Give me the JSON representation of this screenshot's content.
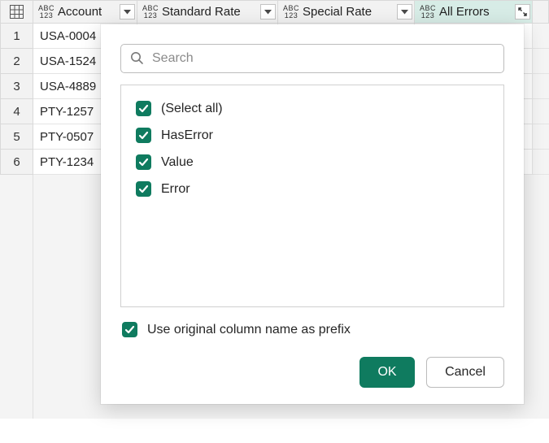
{
  "columns": [
    {
      "label": "Account",
      "width": 128,
      "active": false
    },
    {
      "label": "Standard Rate",
      "width": 173,
      "active": false
    },
    {
      "label": "Special Rate",
      "width": 168,
      "active": false
    },
    {
      "label": "All Errors",
      "width": 145,
      "active": true
    }
  ],
  "rows": [
    {
      "n": "1",
      "account": "USA-0004"
    },
    {
      "n": "2",
      "account": "USA-1524"
    },
    {
      "n": "3",
      "account": "USA-4889"
    },
    {
      "n": "4",
      "account": "PTY-1257"
    },
    {
      "n": "5",
      "account": "PTY-0507"
    },
    {
      "n": "6",
      "account": "PTY-1234"
    }
  ],
  "popup": {
    "search_placeholder": "Search",
    "options": [
      {
        "label": "(Select all)",
        "checked": true
      },
      {
        "label": "HasError",
        "checked": true
      },
      {
        "label": "Value",
        "checked": true
      },
      {
        "label": "Error",
        "checked": true
      }
    ],
    "prefix_label": "Use original column name as prefix",
    "prefix_checked": true,
    "ok_label": "OK",
    "cancel_label": "Cancel"
  }
}
